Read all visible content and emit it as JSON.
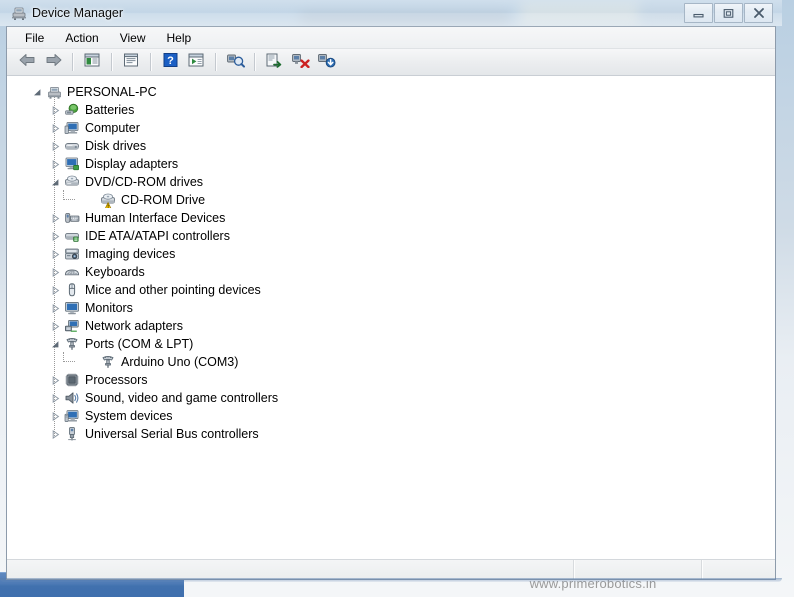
{
  "window": {
    "title": "Device Manager",
    "title_icon": "device-manager-icon",
    "controls": [
      {
        "name": "minimize-button",
        "glyph": "minimize"
      },
      {
        "name": "maximize-button",
        "glyph": "maximize"
      },
      {
        "name": "close-button",
        "glyph": "close"
      }
    ]
  },
  "menubar": {
    "items": [
      {
        "label": "File",
        "name": "menu-file"
      },
      {
        "label": "Action",
        "name": "menu-action"
      },
      {
        "label": "View",
        "name": "menu-view"
      },
      {
        "label": "Help",
        "name": "menu-help"
      }
    ]
  },
  "toolbar": {
    "buttons": [
      {
        "name": "back-button",
        "icon": "back-arrow-icon",
        "tooltip": "Back"
      },
      {
        "name": "forward-button",
        "icon": "forward-arrow-icon",
        "tooltip": "Forward"
      },
      {
        "name": "sep-1",
        "icon": "separator"
      },
      {
        "name": "show-hide-console-tree-button",
        "icon": "console-tree-icon",
        "tooltip": "Show/Hide Console Tree"
      },
      {
        "name": "sep-2",
        "icon": "separator"
      },
      {
        "name": "properties-button",
        "icon": "properties-icon",
        "tooltip": "Properties"
      },
      {
        "name": "sep-3",
        "icon": "separator"
      },
      {
        "name": "help-button",
        "icon": "help-question-icon",
        "tooltip": "Help"
      },
      {
        "name": "show-console-button",
        "icon": "console-play-icon",
        "tooltip": "Show Console"
      },
      {
        "name": "sep-4",
        "icon": "separator"
      },
      {
        "name": "scan-hardware-changes-button",
        "icon": "scan-hardware-icon",
        "tooltip": "Scan for hardware changes"
      },
      {
        "name": "sep-5",
        "icon": "separator"
      },
      {
        "name": "update-driver-button",
        "icon": "update-driver-icon",
        "tooltip": "Update Driver Software"
      },
      {
        "name": "uninstall-device-button",
        "icon": "uninstall-device-icon",
        "tooltip": "Uninstall"
      },
      {
        "name": "disable-enable-device-button",
        "icon": "disable-device-icon",
        "tooltip": "Disable/Enable device"
      }
    ]
  },
  "tree": {
    "nodes": [
      {
        "label": "PERSONAL-PC",
        "level": 0,
        "state": "expanded",
        "icon": "computer-tower-icon",
        "name": "tree-node-personal-pc"
      },
      {
        "label": "Batteries",
        "level": 1,
        "state": "collapsed",
        "icon": "battery-icon",
        "name": "tree-node-batteries"
      },
      {
        "label": "Computer",
        "level": 1,
        "state": "collapsed",
        "icon": "computer-icon",
        "name": "tree-node-computer"
      },
      {
        "label": "Disk drives",
        "level": 1,
        "state": "collapsed",
        "icon": "disk-drive-icon",
        "name": "tree-node-disk-drives"
      },
      {
        "label": "Display adapters",
        "level": 1,
        "state": "collapsed",
        "icon": "display-adapter-icon",
        "name": "tree-node-display-adapters"
      },
      {
        "label": "DVD/CD-ROM drives",
        "level": 1,
        "state": "expanded",
        "icon": "dvd-drive-icon",
        "name": "tree-node-dvd-cd-rom-drives"
      },
      {
        "label": "CD-ROM Drive",
        "level": 2,
        "state": "leaf",
        "icon": "cd-rom-warning-icon",
        "name": "tree-node-cd-rom-drive",
        "warning": true
      },
      {
        "label": "Human Interface Devices",
        "level": 1,
        "state": "collapsed",
        "icon": "hid-icon",
        "name": "tree-node-human-interface-devices"
      },
      {
        "label": "IDE ATA/ATAPI controllers",
        "level": 1,
        "state": "collapsed",
        "icon": "ide-controller-icon",
        "name": "tree-node-ide-ata-atapi-controllers"
      },
      {
        "label": "Imaging devices",
        "level": 1,
        "state": "collapsed",
        "icon": "imaging-device-icon",
        "name": "tree-node-imaging-devices"
      },
      {
        "label": "Keyboards",
        "level": 1,
        "state": "collapsed",
        "icon": "keyboard-icon",
        "name": "tree-node-keyboards"
      },
      {
        "label": "Mice and other pointing devices",
        "level": 1,
        "state": "collapsed",
        "icon": "mouse-icon",
        "name": "tree-node-mice-and-other-pointing-devices"
      },
      {
        "label": "Monitors",
        "level": 1,
        "state": "collapsed",
        "icon": "monitor-icon",
        "name": "tree-node-monitors"
      },
      {
        "label": "Network adapters",
        "level": 1,
        "state": "collapsed",
        "icon": "network-adapter-icon",
        "name": "tree-node-network-adapters"
      },
      {
        "label": "Ports (COM & LPT)",
        "level": 1,
        "state": "expanded",
        "icon": "port-connector-icon",
        "name": "tree-node-ports-com-lpt"
      },
      {
        "label": "Arduino Uno (COM3)",
        "level": 2,
        "state": "leaf",
        "icon": "port-connector-icon",
        "name": "tree-node-arduino-uno-com3"
      },
      {
        "label": "Processors",
        "level": 1,
        "state": "collapsed",
        "icon": "processor-icon",
        "name": "tree-node-processors"
      },
      {
        "label": "Sound, video and game controllers",
        "level": 1,
        "state": "collapsed",
        "icon": "sound-controller-icon",
        "name": "tree-node-sound-video-and-game-controllers"
      },
      {
        "label": "System devices",
        "level": 1,
        "state": "collapsed",
        "icon": "system-device-icon",
        "name": "tree-node-system-devices"
      },
      {
        "label": "Universal Serial Bus controllers",
        "level": 1,
        "state": "collapsed",
        "icon": "usb-controller-icon",
        "name": "tree-node-universal-serial-bus-controllers"
      }
    ]
  },
  "statusbar": {
    "main": "",
    "mid": "",
    "end": ""
  },
  "watermark": {
    "text": "www.primerobotics.in"
  },
  "colors": {
    "accent_blue": "#3f6fae",
    "warning_yellow": "#ffcc00",
    "uninstall_red": "#cc2222",
    "window_bg": "#ffffff",
    "titlebar_glass": "#cddcec"
  }
}
